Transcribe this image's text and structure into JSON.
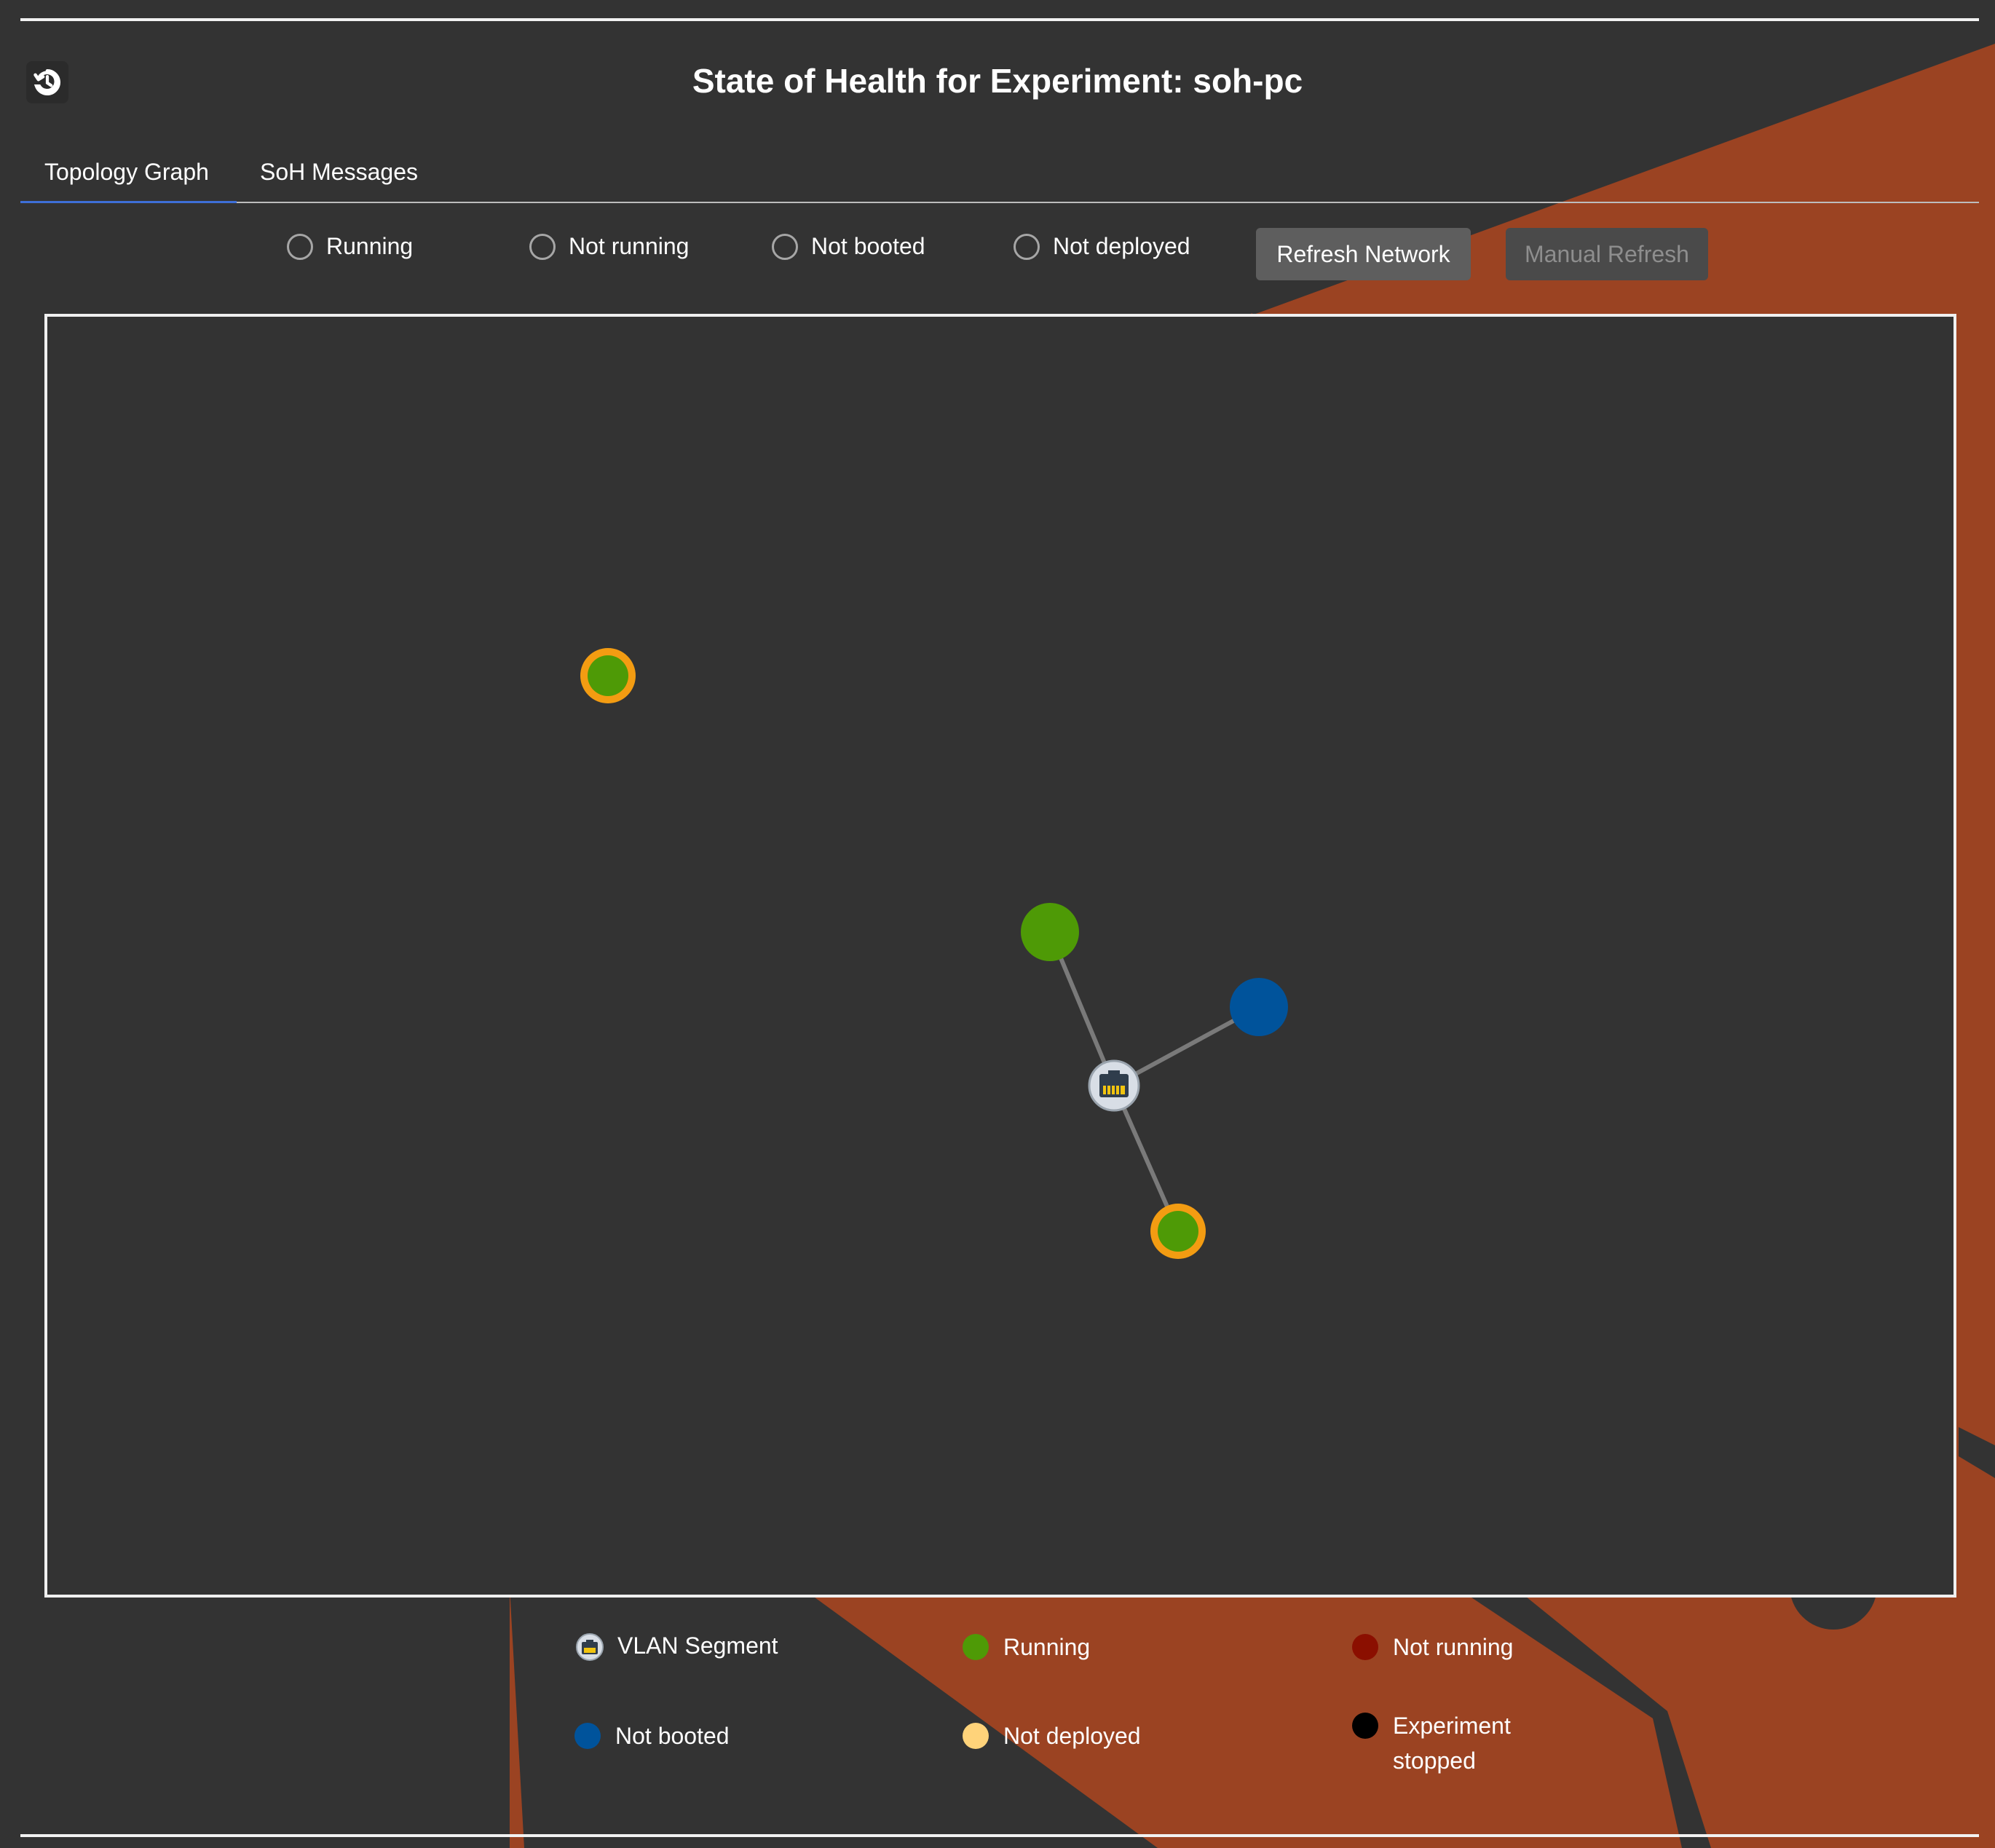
{
  "header": {
    "title": "State of Health for Experiment: soh-pc"
  },
  "tabs": [
    {
      "label": "Topology Graph",
      "active": true
    },
    {
      "label": "SoH Messages",
      "active": false
    }
  ],
  "filters": [
    {
      "label": "Running"
    },
    {
      "label": "Not running"
    },
    {
      "label": "Not booted"
    },
    {
      "label": "Not deployed"
    }
  ],
  "buttons": {
    "refresh_network": "Refresh Network",
    "manual_refresh": "Manual Refresh"
  },
  "graph": {
    "nodes": [
      {
        "id": "n1",
        "status": "running",
        "highlighted": true
      },
      {
        "id": "n2",
        "status": "running",
        "highlighted": false
      },
      {
        "id": "n3",
        "status": "not-booted",
        "highlighted": false
      },
      {
        "id": "vlan",
        "status": "vlan-segment",
        "highlighted": false
      },
      {
        "id": "n4",
        "status": "running",
        "highlighted": true
      }
    ],
    "edges": [
      {
        "from": "vlan",
        "to": "n2"
      },
      {
        "from": "vlan",
        "to": "n3"
      },
      {
        "from": "vlan",
        "to": "n4"
      }
    ]
  },
  "legend": [
    {
      "label": "VLAN Segment",
      "icon": "vlan-segment-icon"
    },
    {
      "label": "Running",
      "color": "#4e9a06"
    },
    {
      "label": "Not running",
      "color": "#8b0f00"
    },
    {
      "label": "Not booted",
      "color": "#00539b"
    },
    {
      "label": "Not deployed",
      "color": "#ffd37a"
    },
    {
      "label": "Experiment stopped",
      "color": "#000000"
    }
  ],
  "colors": {
    "running": "#4e9a06",
    "not_booted": "#00539b",
    "highlight_ring": "#f39c12",
    "edge": "#7a7a7a",
    "vlan": "#d8dee6",
    "background": "#333333",
    "accent_orange": "#9b4322",
    "tab_underline": "#3e6fd8"
  }
}
